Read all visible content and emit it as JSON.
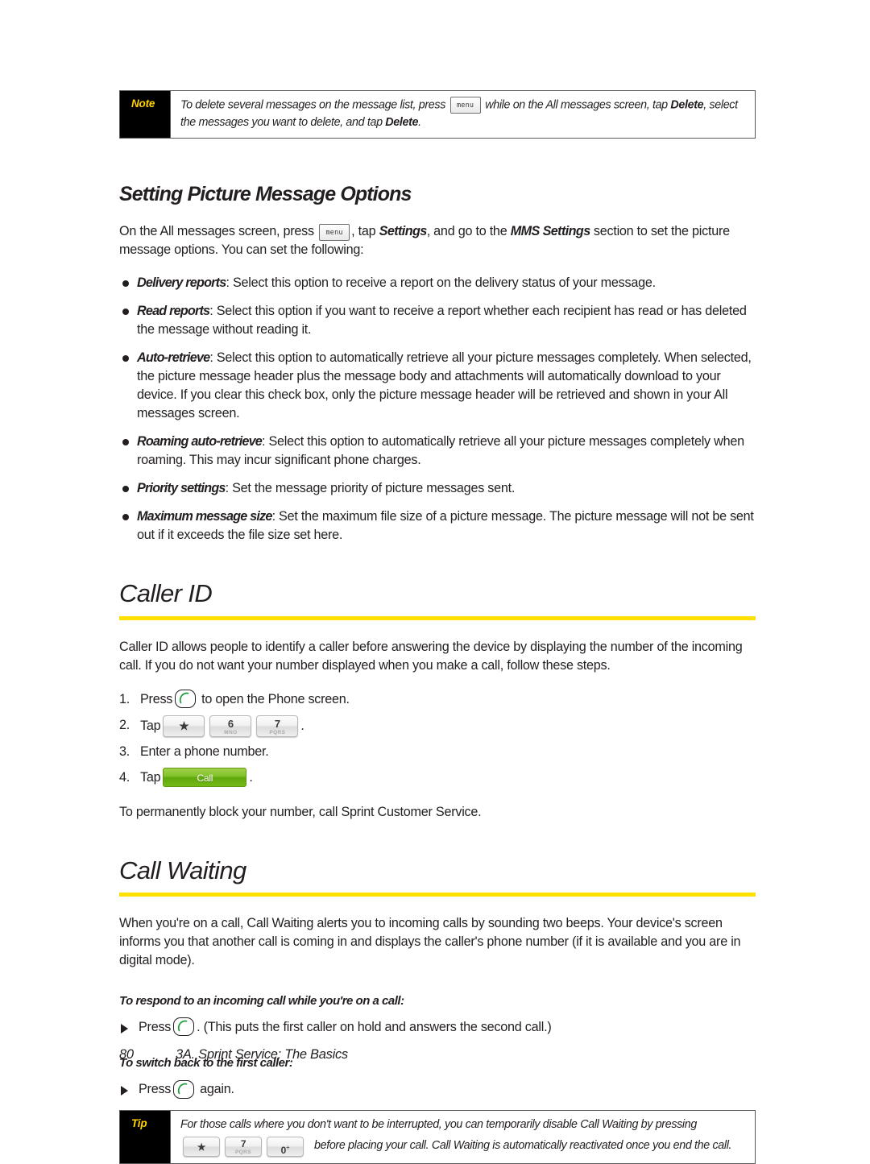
{
  "note_box": {
    "label": "Note",
    "text_a": "To delete several messages on the message list, press",
    "key_menu": "menu",
    "text_b": "while on the All messages screen, tap",
    "bold_b": "Delete",
    "text_c": ", select the messages you want to delete, and tap",
    "bold_c": "Delete",
    "text_d": "."
  },
  "section_picture_options": {
    "heading": "Setting Picture Message Options",
    "intro_a": "On the All messages screen, press",
    "key_menu": "menu",
    "intro_b": ", tap",
    "intro_emph1": "Settings",
    "intro_c": ", and go to the",
    "intro_emph2": "MMS Settings",
    "intro_d": "section to set the picture message options. You can set the following:",
    "bullets": [
      {
        "term": "Delivery reports",
        "text": ": Select this option to receive a report on the delivery status of your message."
      },
      {
        "term": "Read reports",
        "text": ": Select this option if you want to receive a report whether each recipient has read or has deleted the message without reading it."
      },
      {
        "term": "Auto-retrieve",
        "text": ": Select this option to automatically retrieve all your picture messages completely. When selected, the picture message header plus the message body and attachments will automatically download to your device. If you clear this check box, only the picture message header will be retrieved and shown in your All messages screen."
      },
      {
        "term": "Roaming auto-retrieve",
        "text": ": Select this option to automatically retrieve all your picture messages completely when roaming. This may incur significant phone charges."
      },
      {
        "term": "Priority settings",
        "text": ": Set the message priority of picture messages sent."
      },
      {
        "term": "Maximum message size",
        "text": ": Set the maximum file size of a picture message. The picture message will not be sent out if it exceeds the file size set here."
      }
    ]
  },
  "section_caller_id": {
    "heading": "Caller ID",
    "intro": "Caller ID allows people to identify a caller before answering the device by displaying the number of the incoming call. If you do not want your number displayed when you make a call, follow these steps.",
    "step1_a": "Press",
    "step1_b": "to open the Phone screen.",
    "step2_a": "Tap",
    "step2_keys": [
      {
        "num": "★",
        "sub": ""
      },
      {
        "num": "6",
        "sub": "MNO"
      },
      {
        "num": "7",
        "sub": "PQRS"
      }
    ],
    "step2_b": ".",
    "step3": "Enter a phone number.",
    "step4_a": "Tap",
    "step4_button": "Call",
    "step4_b": ".",
    "closing": "To permanently block your number, call Sprint Customer Service."
  },
  "section_call_waiting": {
    "heading": "Call Waiting",
    "intro": "When you're on a call, Call Waiting alerts you to incoming calls by sounding two beeps. Your device's screen informs you that another call is coming in and displays the caller's phone number (if it is available and you are in digital mode).",
    "subhead_1": "To respond to an incoming call while you're on a call:",
    "step_1_a": "Press",
    "step_1_b": ". (This puts the first caller on hold and answers the second call.)",
    "subhead_2": "To switch back to the first caller:",
    "step_2_a": "Press",
    "step_2_b": "again."
  },
  "tip_box": {
    "label": "Tip",
    "line1": "For those calls where you don't want to be interrupted, you can temporarily disable Call Waiting by pressing",
    "keys": [
      {
        "num": "★",
        "sub": ""
      },
      {
        "num": "7",
        "sub": "PQRS"
      },
      {
        "num": "0",
        "sub": "",
        "sup": "+"
      }
    ],
    "line2": "before placing your call. Call Waiting is automatically reactivated once you end the call."
  },
  "footer": {
    "page_number": "80",
    "running_title": "3A. Sprint Service: The Basics"
  },
  "colors": {
    "accent_yellow": "#ffe000",
    "label_yellow": "#ffd200",
    "call_green": "#84c22c",
    "text": "#231f20"
  }
}
